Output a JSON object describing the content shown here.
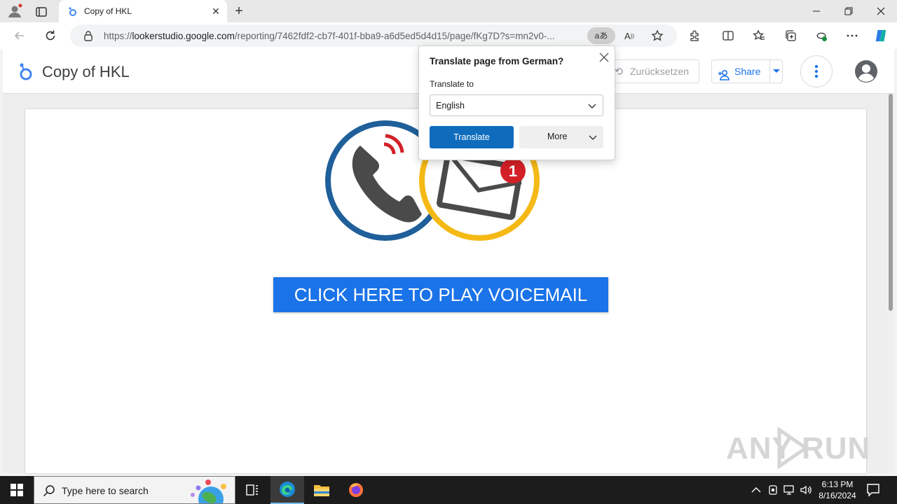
{
  "browser": {
    "tab_title": "Copy of HKL",
    "url_prefix": "https://",
    "url_host": "lookerstudio.google.com",
    "url_path": "/reporting/7462fdf2-cb7f-401f-bba9-a6d5ed5d4d15/page/fKg7D?s=mn2v0-...",
    "translate_chip": "aあ"
  },
  "app": {
    "title": "Copy of HKL",
    "reset_label": "Zurücksetzen",
    "share_label": "Share"
  },
  "report": {
    "cta_label": "CLICK HERE TO PLAY VOICEMAIL",
    "badge_count": "1"
  },
  "translate_popup": {
    "title": "Translate page from German?",
    "translate_to_label": "Translate to",
    "selected_language": "English",
    "translate_button": "Translate",
    "more_button": "More"
  },
  "watermark": {
    "left": "ANY",
    "right": "RUN"
  },
  "taskbar": {
    "search_placeholder": "Type here to search",
    "time": "6:13 PM",
    "date": "8/16/2024"
  },
  "colors": {
    "accent_blue": "#1a73e8",
    "translate_blue": "#0f6cbd",
    "ring_blue": "#1f5f9a",
    "ring_yellow": "#f5b915",
    "badge_red": "#d32027",
    "taskbar": "#1c1c1c"
  }
}
